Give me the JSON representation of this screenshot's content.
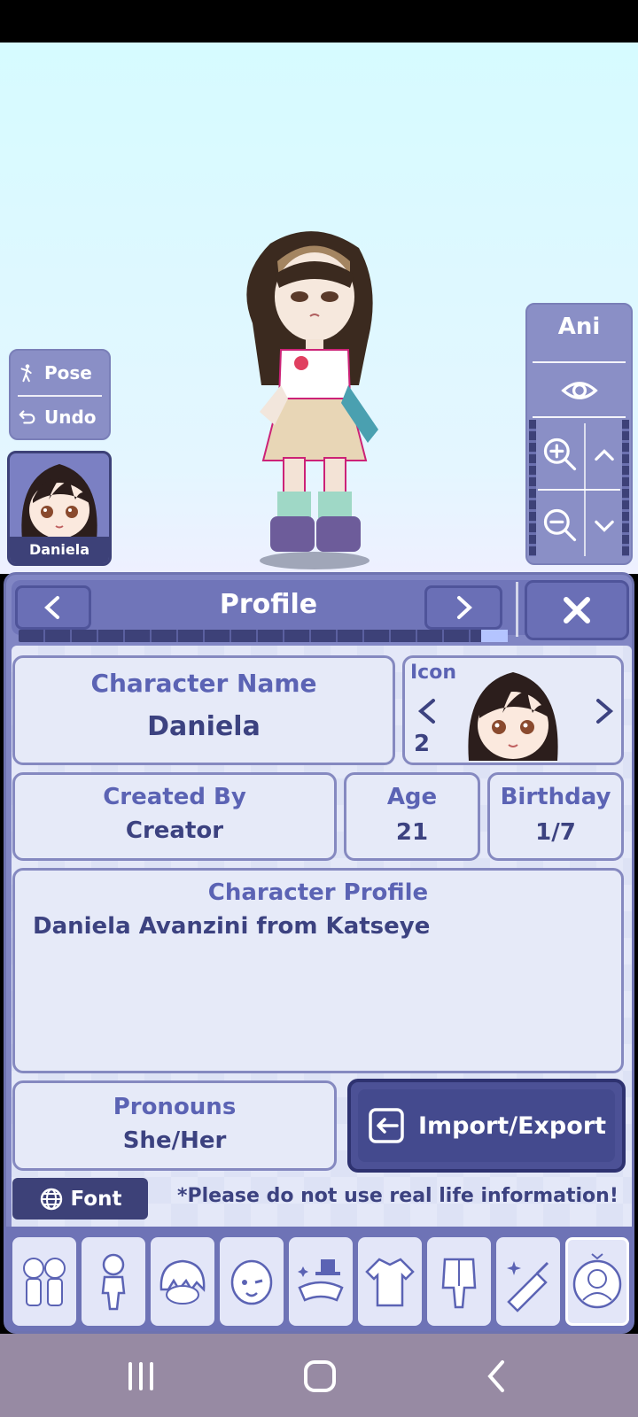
{
  "stage": {
    "pose_label": "Pose",
    "undo_label": "Undo",
    "character_card_name": "Daniela",
    "ani_label": "Ani"
  },
  "profile": {
    "title": "Profile",
    "progress_fraction": 0.95,
    "character_name_label": "Character Name",
    "character_name_value": "Daniela",
    "icon_label": "Icon",
    "icon_number": "2",
    "created_by_label": "Created By",
    "created_by_value": "Creator",
    "age_label": "Age",
    "age_value": "21",
    "birthday_label": "Birthday",
    "birthday_value": "1/7",
    "character_profile_label": "Character Profile",
    "character_profile_text": "Daniela Avanzini from Katseye",
    "pronouns_label": "Pronouns",
    "pronouns_value": "She/Her",
    "import_export_label": "Import/Export",
    "font_label": "Font",
    "note": "*Please do not use real life information!"
  },
  "tabs": [
    "characters-icon",
    "body-icon",
    "hair-icon",
    "face-icon",
    "accessories-icon",
    "top-icon",
    "bottom-icon",
    "props-icon",
    "profile-icon"
  ],
  "colors": {
    "accent": "#8186c4",
    "dark": "#3d4178",
    "label": "#5b63b4",
    "text": "#3c4280"
  }
}
